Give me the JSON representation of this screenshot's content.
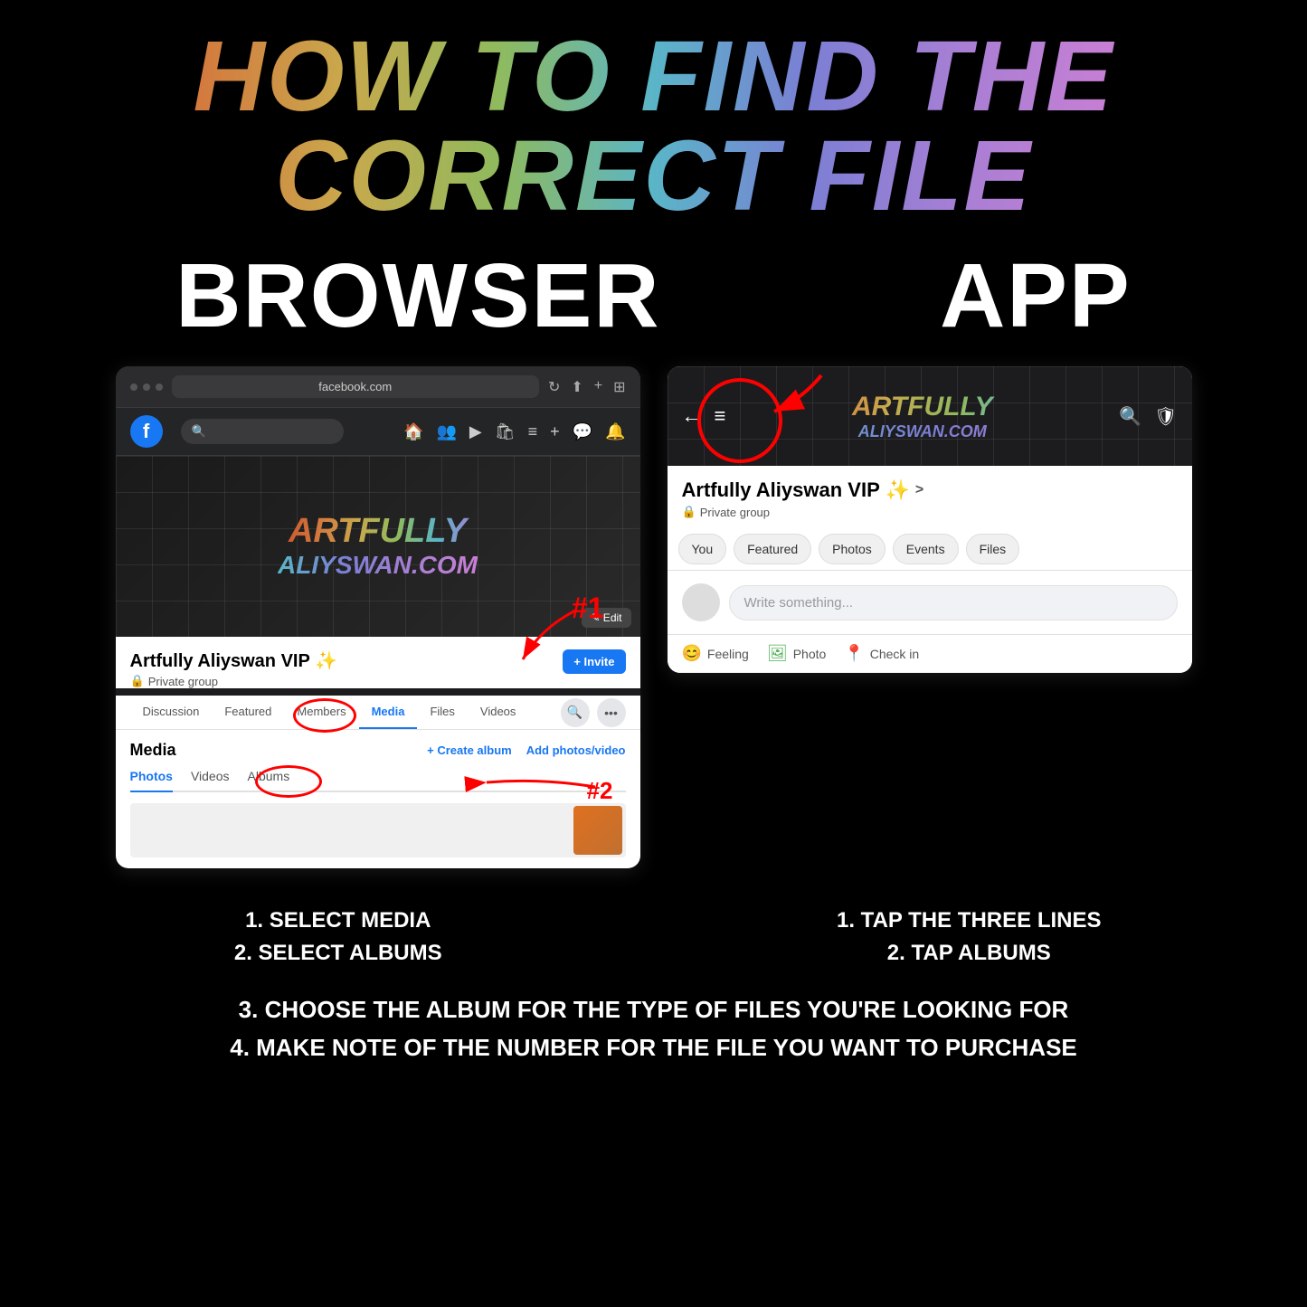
{
  "title": {
    "main": "HOW TO FIND THE CORRECT FILE",
    "browser_label": "BROWSER",
    "app_label": "APP"
  },
  "browser": {
    "url": "facebook.com",
    "fb_logo": "f",
    "group_name": "Artfully Aliyswan VIP ✨",
    "private_label": "Private group",
    "cover_line1": "ARTFULLY",
    "cover_line2": "ALIYSWAN.COM",
    "edit_btn": "✎ Edit",
    "invite_btn": "+ Invite",
    "tabs": [
      "Discussion",
      "Featured",
      "Members",
      "Media",
      "Files",
      "Videos"
    ],
    "active_tab": "Media",
    "media_title": "Media",
    "create_album": "+ Create album",
    "add_photos": "Add photos/video",
    "media_tabs": [
      "Photos",
      "Videos",
      "Albums"
    ],
    "active_media_tab": "Photos",
    "annotation1": "#1",
    "annotation2": "#2"
  },
  "app": {
    "group_name": "Artfully Aliyswan VIP ✨",
    "chevron": ">",
    "private_label": "Private group",
    "header_line1": "ARTFULLY",
    "header_line2": "ALIYSWAN.COM",
    "tabs": [
      "You",
      "Featured",
      "Photos",
      "Events",
      "Files"
    ],
    "write_placeholder": "Write something...",
    "actions": {
      "feeling": "Feeling",
      "photo": "Photo",
      "checkin": "Check in"
    }
  },
  "instructions": {
    "browser": {
      "line1": "1. SELECT MEDIA",
      "line2": "2. SELECT ALBUMS"
    },
    "app": {
      "line1": "1. TAP THE THREE LINES",
      "line2": "2. TAP ALBUMS"
    }
  },
  "bottom": {
    "line1": "3. CHOOSE THE ALBUM FOR THE TYPE OF FILES YOU'RE LOOKING FOR",
    "line2": "4. MAKE NOTE OF THE NUMBER FOR THE FILE YOU WANT TO PURCHASE"
  }
}
